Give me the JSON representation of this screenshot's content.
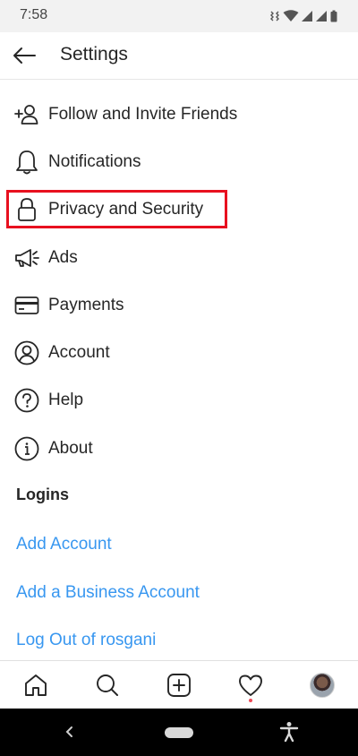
{
  "status_bar": {
    "time": "7:58"
  },
  "header": {
    "title": "Settings"
  },
  "menu": {
    "items": [
      {
        "label": "Follow and Invite Friends",
        "icon": "add-person-icon"
      },
      {
        "label": "Notifications",
        "icon": "bell-icon"
      },
      {
        "label": "Privacy and Security",
        "icon": "lock-icon"
      },
      {
        "label": "Ads",
        "icon": "megaphone-icon"
      },
      {
        "label": "Payments",
        "icon": "credit-card-icon"
      },
      {
        "label": "Account",
        "icon": "account-circle-icon"
      },
      {
        "label": "Help",
        "icon": "help-circle-icon"
      },
      {
        "label": "About",
        "icon": "info-circle-icon"
      }
    ]
  },
  "logins": {
    "header": "Logins",
    "links": [
      {
        "label": "Add Account"
      },
      {
        "label": "Add a Business Account"
      },
      {
        "label": "Log Out of rosgani"
      }
    ]
  },
  "bottom_nav": {
    "items": [
      "home-icon",
      "search-icon",
      "new-post-icon",
      "activity-heart-icon",
      "profile-avatar"
    ]
  },
  "colors": {
    "link": "#3897f0",
    "highlight": "#e8101f",
    "text": "#262626"
  }
}
